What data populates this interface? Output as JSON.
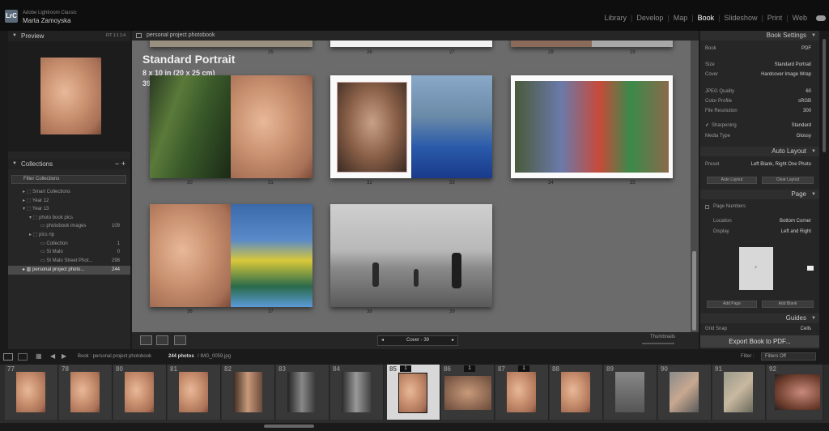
{
  "app": {
    "logo": "LrC",
    "name": "Adobe Lightroom Classic",
    "user": "Marta Zamoyska"
  },
  "modules": [
    {
      "label": "Library",
      "active": false
    },
    {
      "label": "Develop",
      "active": false
    },
    {
      "label": "Map",
      "active": false
    },
    {
      "label": "Book",
      "active": true
    },
    {
      "label": "Slideshow",
      "active": false
    },
    {
      "label": "Print",
      "active": false
    },
    {
      "label": "Web",
      "active": false
    }
  ],
  "preview": {
    "title": "Preview",
    "tools": "FIT  1:1  1:4"
  },
  "collections": {
    "title": "Collections",
    "filter": "Filter Collections",
    "rows": [
      {
        "label": "Smart Collections",
        "count": ""
      },
      {
        "label": "Year 12",
        "count": ""
      },
      {
        "label": "Year 13",
        "count": ""
      },
      {
        "label": "photo book pics",
        "count": ""
      },
      {
        "label": "photobook images",
        "count": "109"
      },
      {
        "label": "pics rip",
        "count": ""
      },
      {
        "label": "Collection",
        "count": "1"
      },
      {
        "label": "St Malo",
        "count": "0"
      },
      {
        "label": "St Malo Street Phot...",
        "count": "298"
      },
      {
        "label": "personal project photo...",
        "count": "244"
      }
    ]
  },
  "center": {
    "header": "personal project photobook",
    "book_title": "Standard Portrait",
    "book_size": "8 x 10 in (20 x 25 cm)",
    "book_pages": "39 pages",
    "top_nums": [
      "25",
      "26",
      "27",
      "28",
      "29"
    ],
    "spread_nums": [
      "30",
      "31",
      "32",
      "33",
      "34",
      "35",
      "36",
      "37",
      "38",
      "39"
    ],
    "cover_label": "Cover - 39",
    "thumbnails_label": "Thumbnails"
  },
  "right": {
    "book_settings": "Book Settings",
    "book_label": "Book",
    "book_value": "PDF",
    "size_label": "Size",
    "size_value": "Standard Portrait",
    "cover_label": "Cover",
    "cover_value": "Hardcover Image Wrap",
    "jpeg_label": "JPEG Quality",
    "jpeg_value": "60",
    "profile_label": "Color Profile",
    "profile_value": "sRGB",
    "res_label": "File Resolution",
    "res_value": "300",
    "sharp_label": "Sharpening",
    "sharp_value": "Standard",
    "media_label": "Media Type",
    "media_value": "Glossy",
    "auto_layout": "Auto Layout",
    "preset_label": "Preset",
    "preset_value": "Left Blank, Right One Photo",
    "auto_btn": "Auto Layout",
    "clear_btn": "Clear Layout",
    "page": "Page",
    "page_numbers": "Page Numbers",
    "location_label": "Location",
    "location_value": "Bottom Corner",
    "display_label": "Display",
    "display_value": "Left and Right",
    "add_page": "Add Page",
    "add_blank": "Add Blank",
    "guides": "Guides",
    "grid_snap": "Grid Snap",
    "grid_snap_value": "Cells",
    "export": "Export Book to PDF..."
  },
  "filmbar": {
    "path": "Book : personal project photobook",
    "count": "244 photos",
    "file": "/ IMG_0059.jpg",
    "filter_label": "Filter :",
    "filter_value": "Filters Off"
  },
  "filmstrip": [
    {
      "num": "77",
      "badge": ""
    },
    {
      "num": "78",
      "badge": ""
    },
    {
      "num": "80",
      "badge": ""
    },
    {
      "num": "81",
      "badge": ""
    },
    {
      "num": "82",
      "badge": ""
    },
    {
      "num": "83",
      "badge": ""
    },
    {
      "num": "84",
      "badge": ""
    },
    {
      "num": "85",
      "badge": "1"
    },
    {
      "num": "86",
      "badge": "1"
    },
    {
      "num": "87",
      "badge": "1"
    },
    {
      "num": "88",
      "badge": ""
    },
    {
      "num": "89",
      "badge": ""
    },
    {
      "num": "90",
      "badge": ""
    },
    {
      "num": "91",
      "badge": ""
    },
    {
      "num": "92",
      "badge": ""
    }
  ]
}
